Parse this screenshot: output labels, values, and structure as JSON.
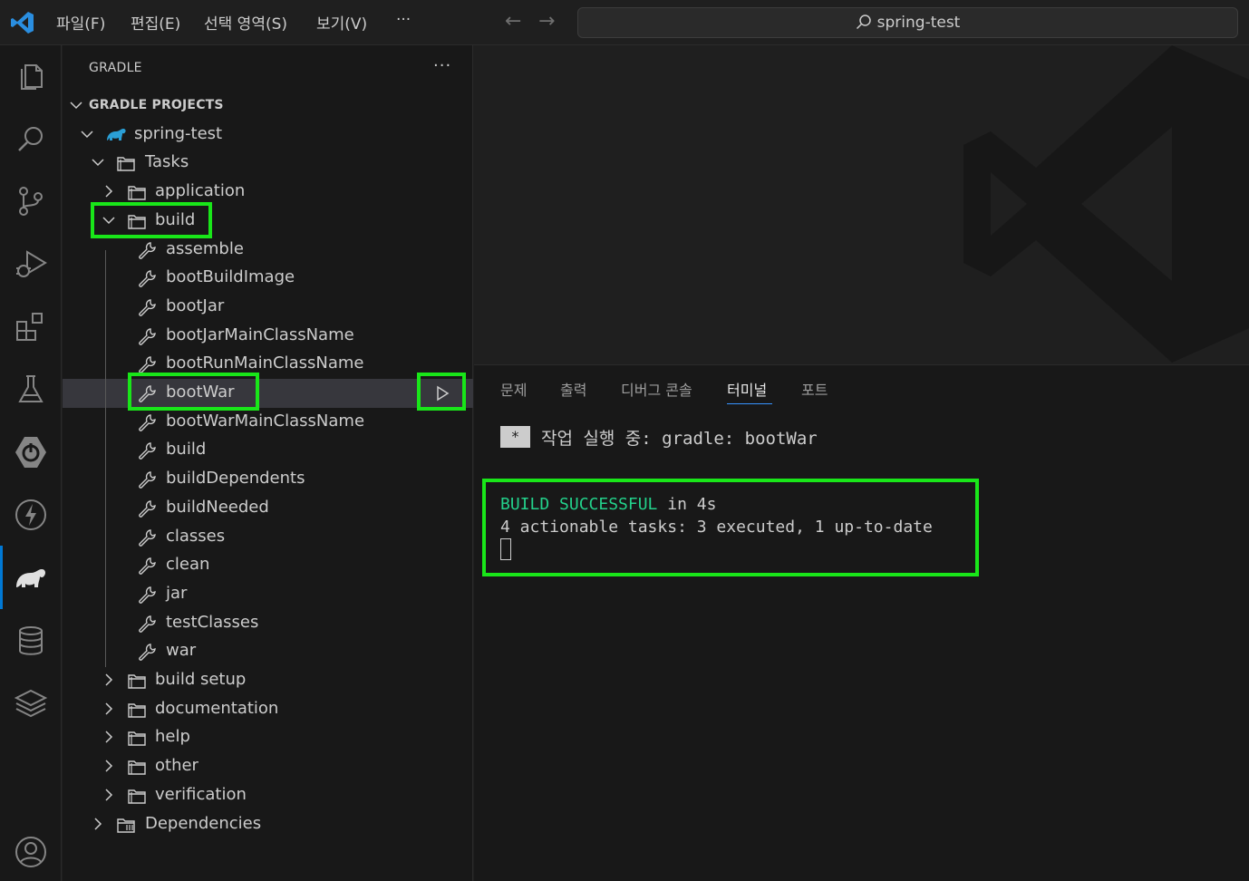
{
  "titlebar": {
    "menu": [
      "파일(F)",
      "편집(E)",
      "선택 영역(S)",
      "보기(V)",
      "···"
    ],
    "back_icon": "arrow-left-icon",
    "forward_icon": "arrow-right-icon",
    "search_text": "spring-test"
  },
  "activitybar": {
    "icons": [
      "explorer-icon",
      "search-icon",
      "source-control-icon",
      "run-debug-icon",
      "extensions-icon",
      "testing-icon",
      "spring-boot-icon",
      "lightning-icon",
      "gradle-elephant-icon",
      "database-icon",
      "layers-icon",
      "account-icon"
    ],
    "active": "gradle-elephant-icon"
  },
  "sidebar": {
    "title": "GRADLE",
    "more": "···",
    "section": "GRADLE PROJECTS",
    "project": "spring-test",
    "tasks_label": "Tasks",
    "groups_before": [
      "application"
    ],
    "build_group": "build",
    "build_tasks": [
      "assemble",
      "bootBuildImage",
      "bootJar",
      "bootJarMainClassName",
      "bootRunMainClassName",
      "bootWar",
      "bootWarMainClassName",
      "build",
      "buildDependents",
      "buildNeeded",
      "classes",
      "clean",
      "jar",
      "testClasses",
      "war"
    ],
    "selected_task": "bootWar",
    "groups_after": [
      "build setup",
      "documentation",
      "help",
      "other",
      "verification"
    ],
    "dependencies_label": "Dependencies"
  },
  "panel": {
    "tabs": [
      "문제",
      "출력",
      "디버그 콘솔",
      "터미널",
      "포트"
    ],
    "active_tab": "터미널",
    "terminal": {
      "task_marker": "*",
      "task_line": "작업 실행 중: gradle: bootWar",
      "build_status": "BUILD SUCCESSFUL",
      "build_time": " in 4s",
      "summary_line": "4 actionable tasks: 3 executed, 1 up-to-date"
    }
  },
  "colors": {
    "highlight": "#19e619",
    "accent": "#0078d4",
    "success": "#23d18b"
  }
}
